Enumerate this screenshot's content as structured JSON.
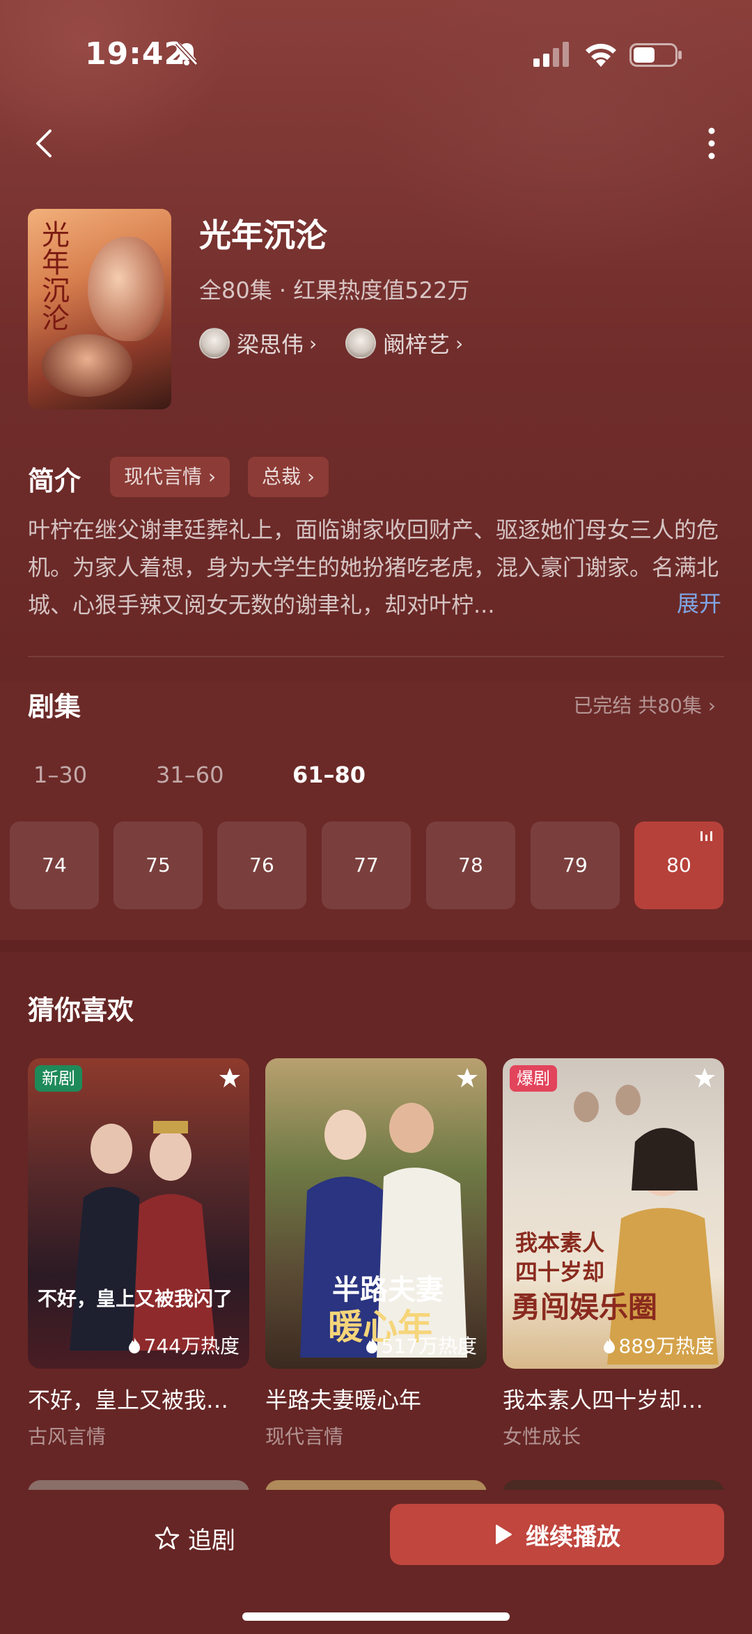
{
  "status": {
    "time": "19:42"
  },
  "drama": {
    "title": "光年沉沦",
    "poster_text": "光年沉沦",
    "meta": "全80集 · 红果热度值522万",
    "actors": [
      {
        "name": "梁思伟",
        "chevron": "›"
      },
      {
        "name": "阚梓艺",
        "chevron": "›"
      }
    ]
  },
  "intro": {
    "heading": "简介",
    "tags": [
      "现代言情 ›",
      "总裁 ›"
    ],
    "text": "叶柠在继父谢聿廷葬礼上，面临谢家收回财产、驱逐她们母女三人的危机。为家人着想，身为大学生的她扮猪吃老虎，混入豪门谢家。名满北城、心狠手辣又阅女无数的谢聿礼，却对叶柠...",
    "expand_label": "展开"
  },
  "episodes": {
    "heading": "剧集",
    "status": "已完结 共80集 ›",
    "ranges": [
      "1–30",
      "31–60",
      "61–80"
    ],
    "active_range": "61–80",
    "items": [
      "74",
      "75",
      "76",
      "77",
      "78",
      "79",
      "80"
    ],
    "current": "80"
  },
  "recommend": {
    "heading": "猜你喜欢",
    "cards": [
      {
        "badge": "新剧",
        "badge_color": "#1e8a5a",
        "heat": "744万热度",
        "name": "不好，皇上又被我…",
        "genre": "古风言情",
        "poster_text": "不好，皇上又被我闪了"
      },
      {
        "badge": "",
        "badge_color": "",
        "heat": "517万热度",
        "name": "半路夫妻暖心年",
        "genre": "现代言情",
        "poster_text_1": "半路夫妻",
        "poster_text_2": "暖心年"
      },
      {
        "badge": "爆剧",
        "badge_color": "#e2445c",
        "heat": "889万热度",
        "name": "我本素人四十岁却…",
        "genre": "女性成长",
        "poster_text_1": "我本素人",
        "poster_text_2": "四十岁却",
        "poster_text_3": "勇闯娱乐圈"
      }
    ]
  },
  "bottom": {
    "follow_label": "追剧",
    "play_label": "继续播放"
  },
  "colors": {
    "background": "#6b2a28",
    "accent": "#c0463e",
    "link": "#7fa6e6"
  },
  "icons": [
    "bell-slash-icon",
    "signal-icon",
    "wifi-icon",
    "battery-icon",
    "back-icon",
    "more-icon",
    "star-icon",
    "flame-icon",
    "play-icon",
    "playing-bars-icon"
  ]
}
